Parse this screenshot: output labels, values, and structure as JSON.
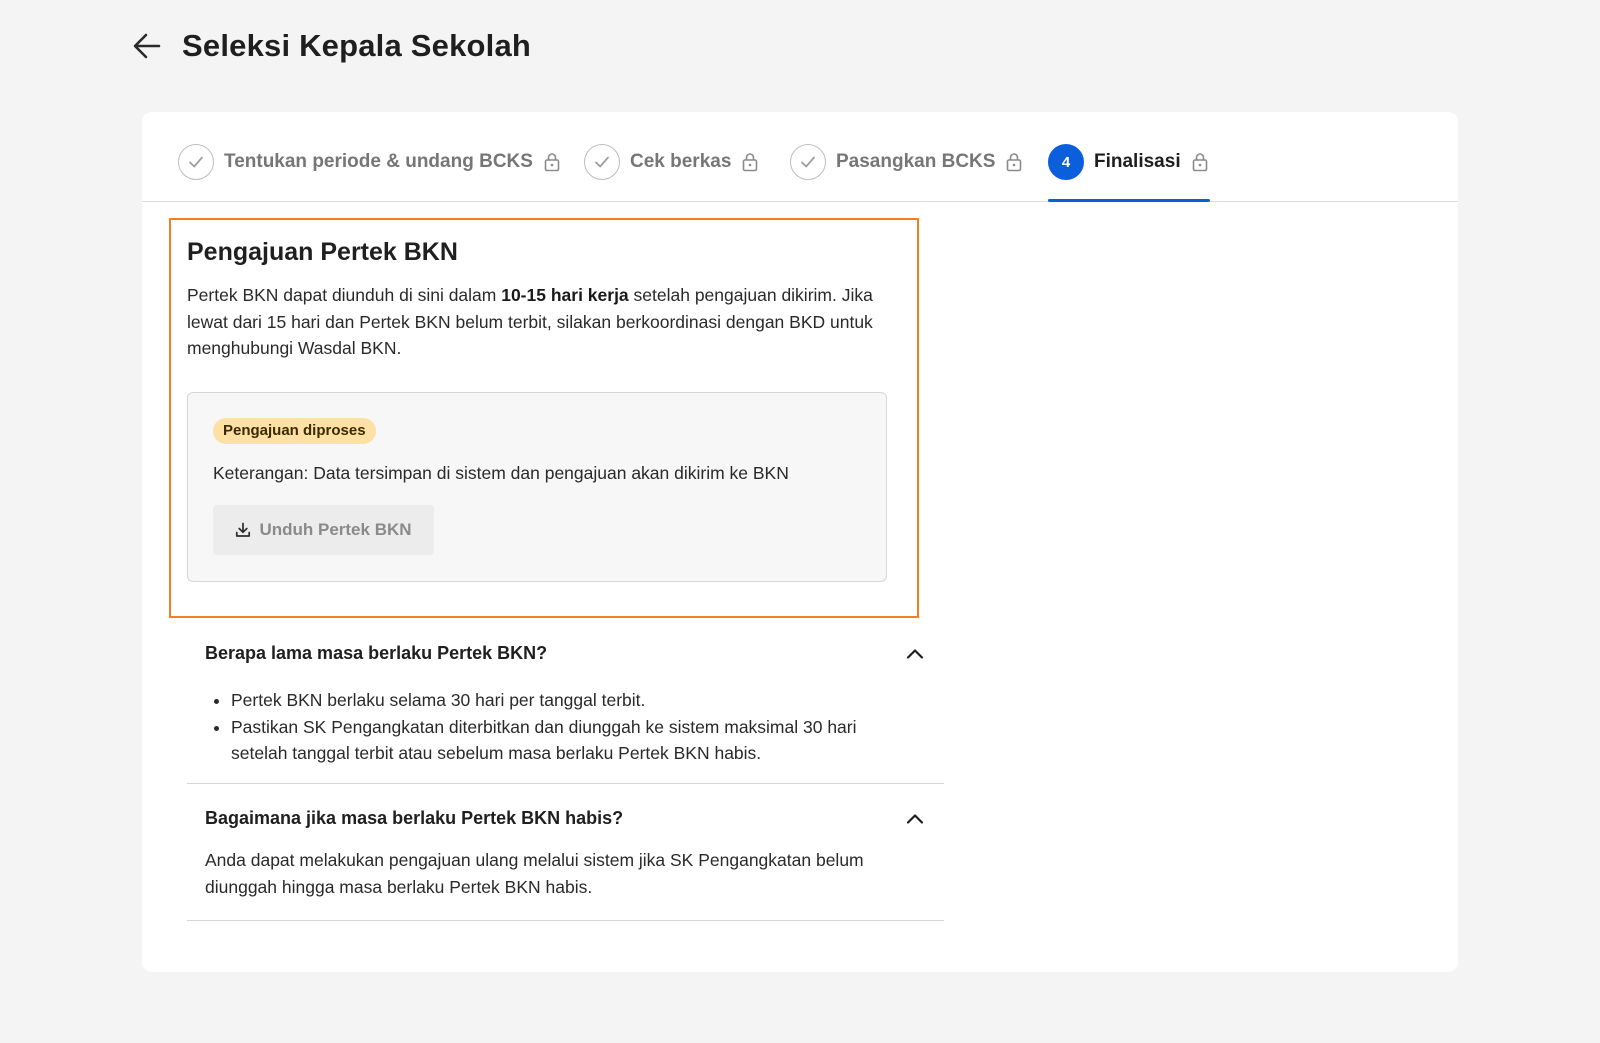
{
  "header": {
    "title": "Seleksi Kepala Sekolah",
    "back_icon": "arrow-left-icon"
  },
  "stepper": {
    "steps": [
      {
        "label": "Tentukan periode & undang BCKS",
        "state": "done"
      },
      {
        "label": "Cek berkas",
        "state": "done"
      },
      {
        "label": "Pasangkan BCKS",
        "state": "done"
      },
      {
        "number": "4",
        "label": "Finalisasi",
        "state": "active"
      }
    ],
    "active_color": "#0b5fdd"
  },
  "pertek": {
    "title": "Pengajuan Pertek BKN",
    "desc_part1": "Pertek BKN dapat diunduh di sini dalam ",
    "desc_bold": "10-15 hari kerja",
    "desc_part2": " setelah pengajuan dikirim. Jika lewat dari 15 hari dan Pertek BKN belum terbit, silakan berkoordinasi dengan BKD untuk menghubungi Wasdal BKN.",
    "status_badge": "Pengajuan diproses",
    "keterangan": "Keterangan: Data tersimpan di sistem dan pengajuan akan dikirim ke BKN",
    "download_label": "Unduh Pertek BKN",
    "highlight_color": "#f5801f",
    "badge_color": "#fde0a4"
  },
  "faq": [
    {
      "question": "Berapa lama masa berlaku Pertek BKN?",
      "bullets": [
        "Pertek BKN berlaku selama 30 hari per tanggal terbit.",
        "Pastikan SK Pengangkatan diterbitkan dan diunggah ke sistem maksimal 30 hari setelah tanggal terbit atau sebelum masa berlaku Pertek BKN habis."
      ]
    },
    {
      "question": "Bagaimana jika masa berlaku Pertek BKN habis?",
      "answer": "Anda dapat melakukan pengajuan ulang melalui sistem jika SK Pengangkatan belum diunggah hingga masa berlaku Pertek BKN habis."
    }
  ]
}
